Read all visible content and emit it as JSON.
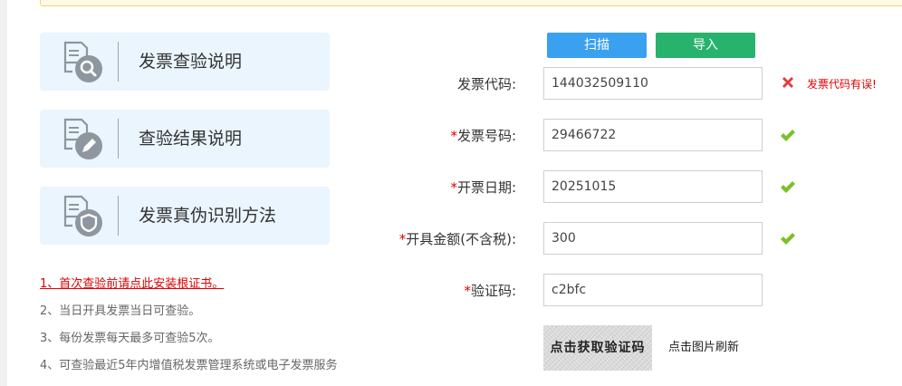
{
  "info_cards": [
    {
      "label": "发票查验说明",
      "icon": "search-document-icon"
    },
    {
      "label": "查验结果说明",
      "icon": "edit-document-icon"
    },
    {
      "label": "发票真伪识别方法",
      "icon": "shield-document-icon"
    }
  ],
  "tips": [
    "1、首次查验前请点此安装根证书。",
    "2、当日开具发票当日可查验。",
    "3、每份发票每天最多可查验5次。",
    "4、可查验最近5年内增值税发票管理系统或电子发票服务"
  ],
  "buttons": {
    "scan": "扫描",
    "import": "导入"
  },
  "form": {
    "invoice_code": {
      "label": "发票代码:",
      "value": "144032509110",
      "error": "发票代码有误!"
    },
    "invoice_number": {
      "required": "*",
      "label": "发票号码:",
      "value": "29466722"
    },
    "issue_date": {
      "required": "*",
      "label": "开票日期:",
      "value": "20251015"
    },
    "amount": {
      "required": "*",
      "label": "开具金额(不含税):",
      "value": "300"
    },
    "captcha": {
      "required": "*",
      "label": "验证码:",
      "value": "c2bfc"
    }
  },
  "captcha_image_text": "点击获取验证码",
  "refresh_hint": "点击图片刷新",
  "colors": {
    "error": "#e00000",
    "success": "#7cc02a",
    "scan": "#3aa0f0",
    "import": "#27b26e",
    "card_bg": "#eaf5fd"
  }
}
